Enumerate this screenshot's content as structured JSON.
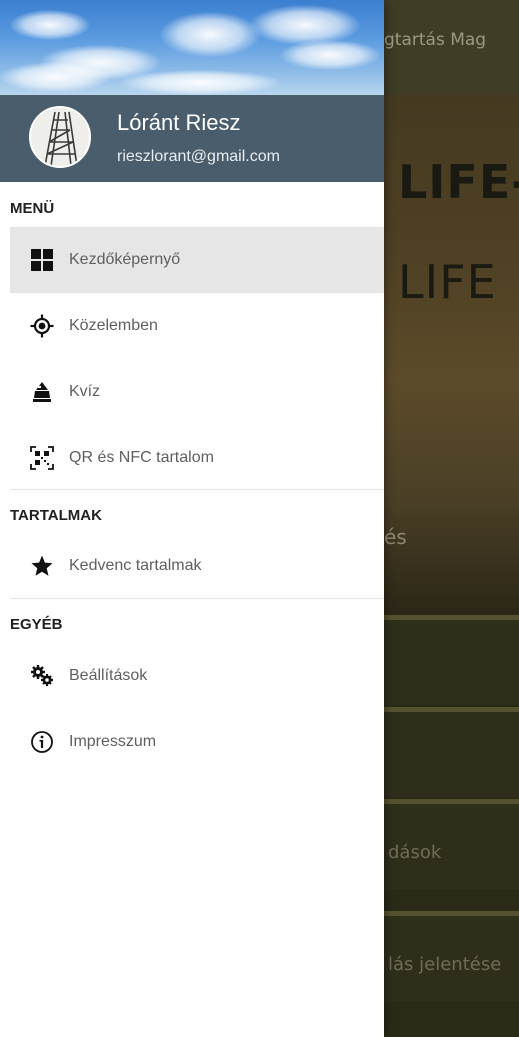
{
  "background_app": {
    "toolbar_title": "gtartás Mag",
    "hero_line1": "LIFE-",
    "hero_line2": "LIFE",
    "hero_caption": "és",
    "rows": [
      "",
      "",
      "dások",
      "lás jelentése"
    ]
  },
  "drawer": {
    "user": {
      "name": "Lóránt Riesz",
      "email": "rieszlorant@gmail.com"
    },
    "sections": [
      {
        "title": "MENÜ",
        "items": [
          {
            "label": "Kezdőképernyő",
            "icon": "grid-icon",
            "selected": true
          },
          {
            "label": "Közelemben",
            "icon": "location-target-icon",
            "selected": false
          },
          {
            "label": "Kvíz",
            "icon": "quiz-icon",
            "selected": false
          },
          {
            "label": "QR és NFC tartalom",
            "icon": "qr-code-icon",
            "selected": false
          }
        ]
      },
      {
        "title": "TARTALMAK",
        "items": [
          {
            "label": "Kedvenc tartalmak",
            "icon": "star-icon",
            "selected": false
          }
        ]
      },
      {
        "title": "EGYÉB",
        "items": [
          {
            "label": "Beállítások",
            "icon": "gears-icon",
            "selected": false
          },
          {
            "label": "Impresszum",
            "icon": "info-icon",
            "selected": false
          }
        ]
      }
    ]
  },
  "colors": {
    "profile_band": "#4a5d6c",
    "selected_item_bg": "#e6e6e6",
    "item_text": "#5f5f5f",
    "section_header_text": "#212121"
  }
}
